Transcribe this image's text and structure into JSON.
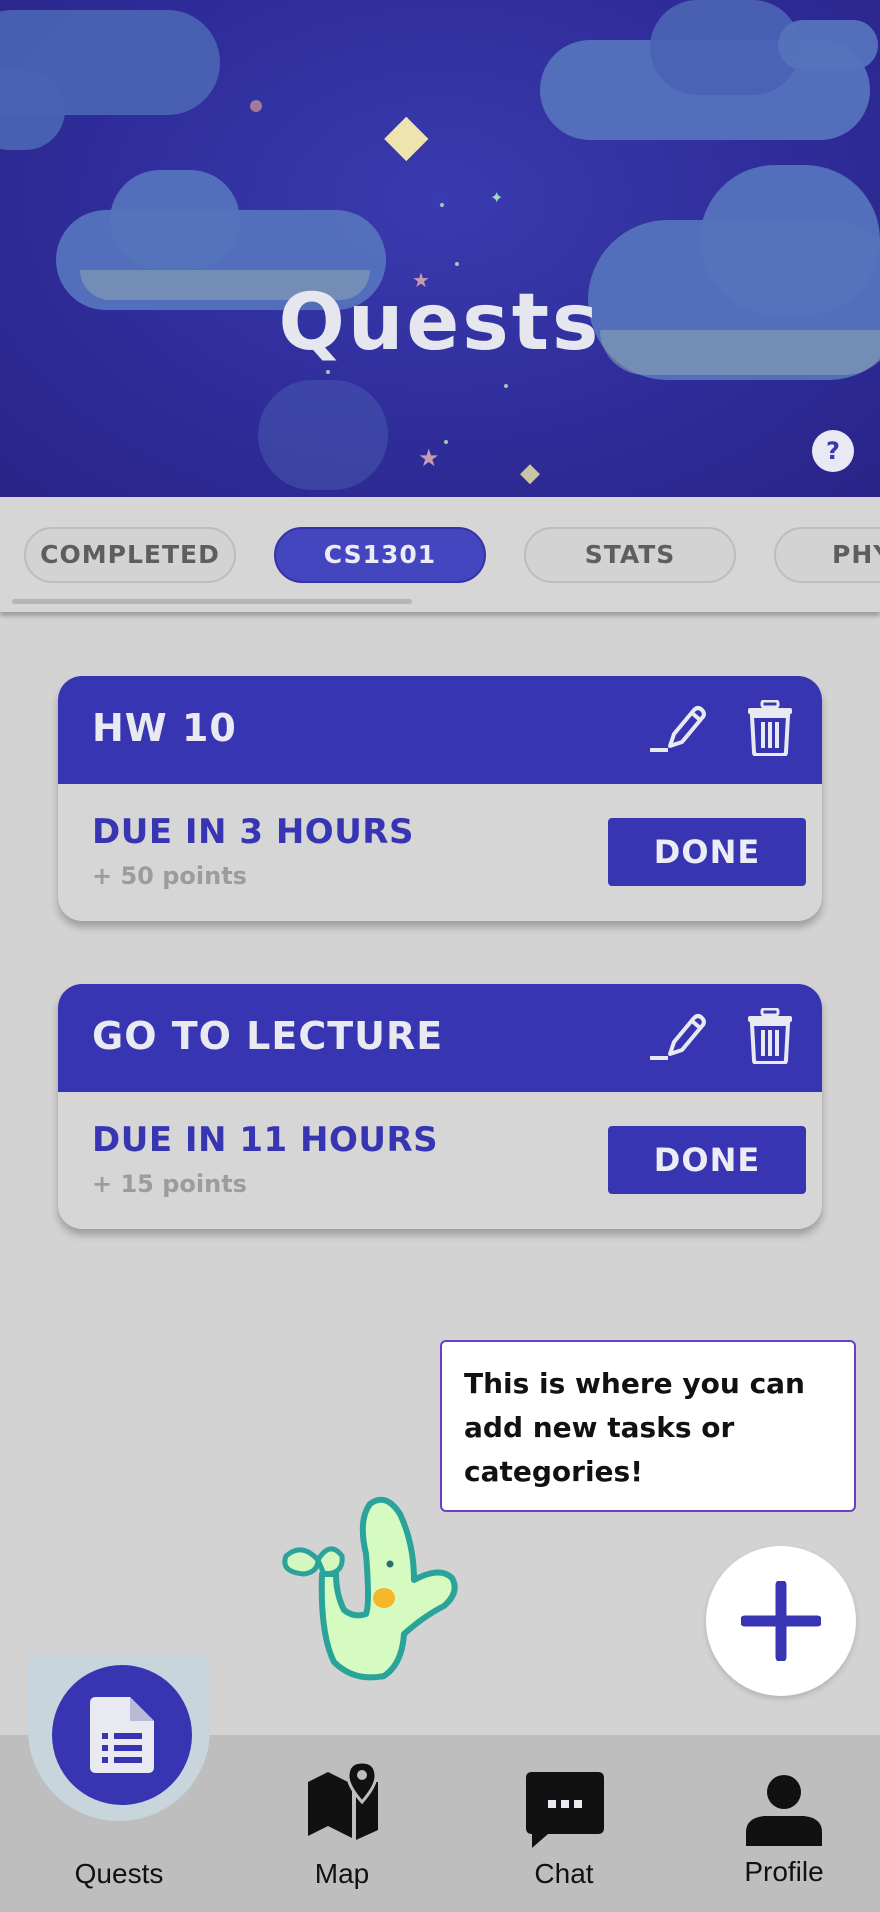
{
  "header": {
    "title": "Quests",
    "help_label": "?"
  },
  "tabs": [
    {
      "label": "COMPLETED",
      "active": false
    },
    {
      "label": "CS1301",
      "active": true
    },
    {
      "label": "STATS",
      "active": false
    },
    {
      "label": "PHY",
      "active": false
    }
  ],
  "quests": [
    {
      "title": "HW 10",
      "due": "DUE IN 3 HOURS",
      "points": "+ 50 points",
      "done_label": "DONE"
    },
    {
      "title": "GO TO LECTURE",
      "due": "DUE IN 11 HOURS",
      "points": "+ 15 points",
      "done_label": "DONE"
    }
  ],
  "tooltip": {
    "text": "This is where you can add new tasks or categories!"
  },
  "nav": [
    {
      "label": "Quests",
      "icon": "document-icon",
      "active": true
    },
    {
      "label": "Map",
      "icon": "map-icon",
      "active": false
    },
    {
      "label": "Chat",
      "icon": "chat-icon",
      "active": false
    },
    {
      "label": "Profile",
      "icon": "person-icon",
      "active": false
    }
  ],
  "colors": {
    "primary": "#3835b2",
    "background": "#d3d3d3",
    "header_sky": "#2f2d9a"
  }
}
